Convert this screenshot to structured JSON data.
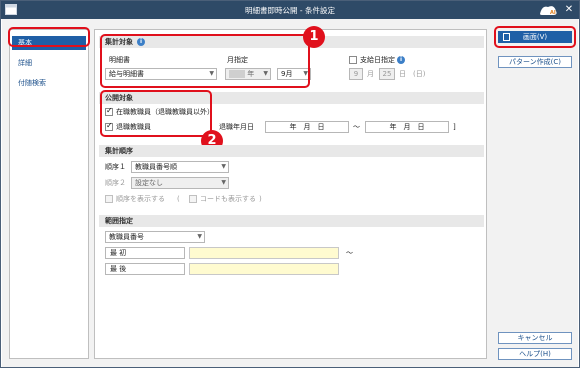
{
  "window": {
    "title": "明細書即時公開 - 条件設定"
  },
  "nav": {
    "items": [
      "基本",
      "詳細",
      "付随検索"
    ]
  },
  "summary": {
    "header": "集計対象",
    "statement_label": "明細書",
    "statement_value": "給与明細書",
    "month_label": "月指定",
    "year_suffix": "年",
    "month_value": "9月",
    "payday_label": "支給日指定",
    "payday_month": "9",
    "month_unit": "月",
    "payday_day": "25",
    "day_unit": "日",
    "weekday": "(日)"
  },
  "publish": {
    "header": "公開対象",
    "active_label": "在職教職員（退職教職員以外）",
    "retired_label": "退職教職員",
    "retire_date_label": "退職年月日",
    "date_from": "年　月　日",
    "tilde": "～",
    "date_to": "年　月　日",
    "close_bracket": "]"
  },
  "order": {
    "header": "集計順序",
    "order1_label": "順序１",
    "order1_value": "教職員番号順",
    "order2_label": "順序２",
    "order2_value": "設定なし",
    "show_order_label": "順序を表示する",
    "open_paren": "(",
    "show_code_label": "コードも表示する",
    "close_paren": ")"
  },
  "range": {
    "header": "範囲指定",
    "field_value": "教職員番号",
    "first_label": "最 初",
    "last_label": "最 後",
    "tilde": "～"
  },
  "buttons": {
    "print": "画面(V)",
    "pattern": "パターン作成(C)",
    "cancel": "キャンセル",
    "help": "ヘルプ(H)"
  },
  "annotations": {
    "badge1": "1",
    "badge2": "2"
  },
  "colors": {
    "titlebar": "#2e4a67",
    "accent": "#1f5fa6",
    "highlight": "#e0101c"
  }
}
